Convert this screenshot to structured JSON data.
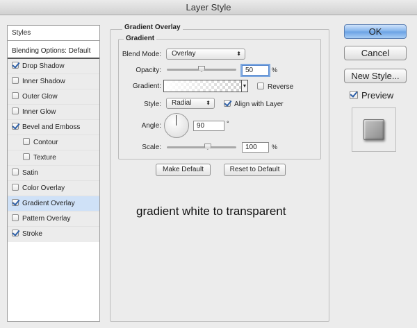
{
  "window": {
    "title": "Layer Style"
  },
  "styles_list": {
    "header": "Styles",
    "blending_options": "Blending Options: Default",
    "items": [
      {
        "label": "Drop Shadow",
        "checked": true
      },
      {
        "label": "Inner Shadow",
        "checked": false
      },
      {
        "label": "Outer Glow",
        "checked": false
      },
      {
        "label": "Inner Glow",
        "checked": false
      },
      {
        "label": "Bevel and Emboss",
        "checked": true
      },
      {
        "label": "Contour",
        "checked": false
      },
      {
        "label": "Texture",
        "checked": false
      },
      {
        "label": "Satin",
        "checked": false
      },
      {
        "label": "Color Overlay",
        "checked": false
      },
      {
        "label": "Gradient Overlay",
        "checked": true,
        "selected": true
      },
      {
        "label": "Pattern Overlay",
        "checked": false
      },
      {
        "label": "Stroke",
        "checked": true
      }
    ]
  },
  "panel": {
    "section_title": "Gradient Overlay",
    "group_title": "Gradient",
    "blend_mode_label": "Blend Mode:",
    "blend_mode_value": "Overlay",
    "opacity_label": "Opacity:",
    "opacity_value": "50",
    "opacity_unit": "%",
    "opacity_level": 50,
    "gradient_label": "Gradient:",
    "reverse_label": "Reverse",
    "reverse_checked": false,
    "style_label": "Style:",
    "style_value": "Radial",
    "align_label": "Align with Layer",
    "align_checked": true,
    "angle_label": "Angle:",
    "angle_value": "90",
    "angle_unit": "°",
    "scale_label": "Scale:",
    "scale_value": "100",
    "scale_unit": "%",
    "scale_level": 100,
    "make_default": "Make Default",
    "reset_default": "Reset to Default"
  },
  "annotation": "gradient white to transparent",
  "buttons": {
    "ok": "OK",
    "cancel": "Cancel",
    "new_style": "New Style...",
    "preview_label": "Preview",
    "preview_checked": true
  }
}
